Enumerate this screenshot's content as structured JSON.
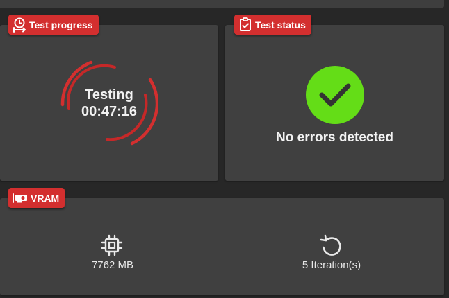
{
  "panels": {
    "test_progress": {
      "label": "Test progress",
      "state": "Testing",
      "elapsed": "00:47:16"
    },
    "test_status": {
      "label": "Test status",
      "message": "No errors detected"
    },
    "vram": {
      "label": "VRAM",
      "memory": "7762 MB",
      "iterations": "5 Iteration(s)"
    }
  },
  "colors": {
    "accent_red": "#d32f2f",
    "success_green": "#64dd17",
    "card_bg": "#404040",
    "page_bg": "#272727"
  },
  "icons": {
    "progress": "timer-icon",
    "status": "clipboard-check-icon",
    "vram": "graphics-card-icon",
    "memory": "chip-icon",
    "iterations": "reload-icon",
    "status_indicator": "checkmark-icon"
  }
}
